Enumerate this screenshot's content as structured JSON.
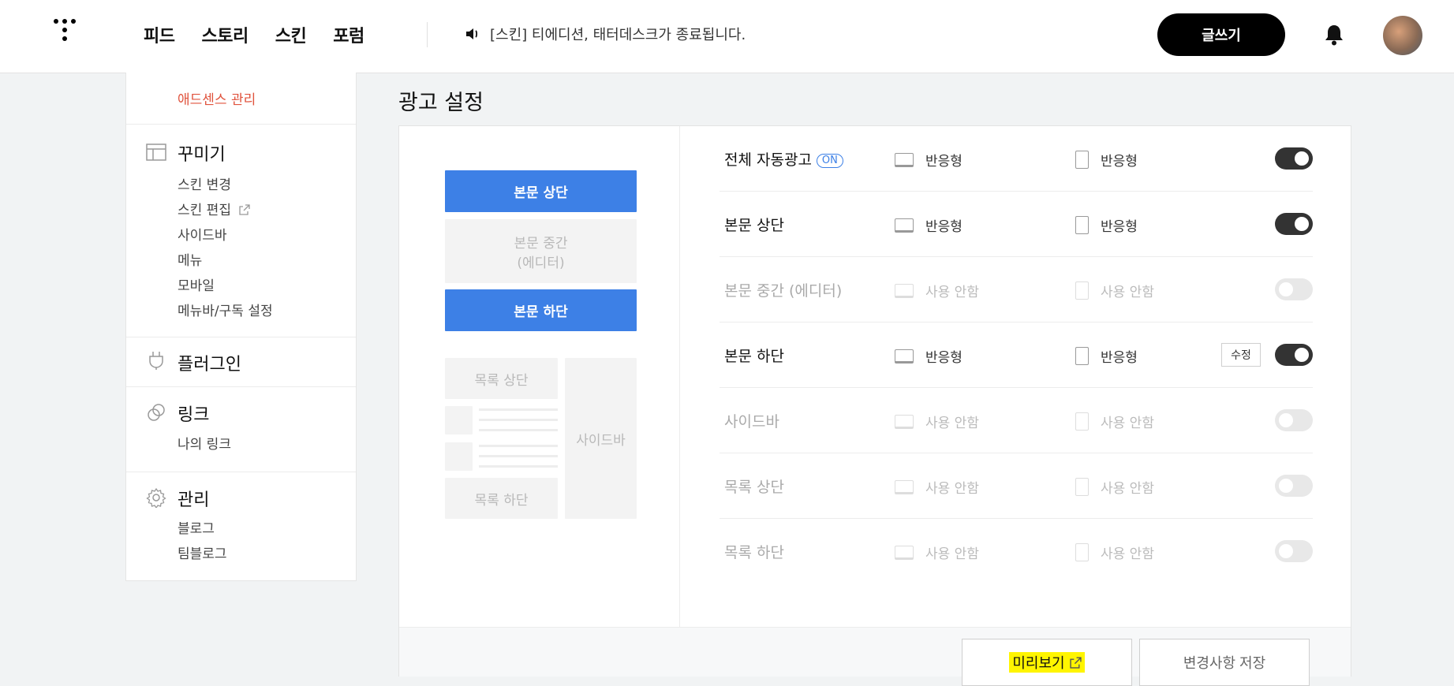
{
  "nav": {
    "items": [
      "피드",
      "스토리",
      "스킨",
      "포럼"
    ]
  },
  "notice": "[스킨] 티에디션, 태터데스크가 종료됩니다.",
  "header": {
    "write_label": "글쓰기"
  },
  "sidebar": {
    "adsense": "애드센스 관리",
    "groups": [
      {
        "title": "꾸미기",
        "icon": "layout-icon",
        "items": [
          "스킨 변경",
          "스킨 편집",
          "사이드바",
          "메뉴",
          "모바일",
          "메뉴바/구독 설정"
        ]
      },
      {
        "title": "플러그인",
        "icon": "plug-icon",
        "items": []
      },
      {
        "title": "링크",
        "icon": "link-icon",
        "items": [
          "나의 링크"
        ]
      },
      {
        "title": "관리",
        "icon": "gear-icon",
        "items": [
          "블로그",
          "팀블로그"
        ]
      }
    ]
  },
  "page": {
    "title": "광고 설정"
  },
  "preview": {
    "top": "본문 상단",
    "middle_line1": "본문 중간",
    "middle_line2": "(에디터)",
    "bottom": "본문 하단",
    "list_top": "목록 상단",
    "list_bottom": "목록 하단",
    "sidebar": "사이드바"
  },
  "rows": [
    {
      "label": "전체 자동광고",
      "badge": "ON",
      "pc": "반응형",
      "mobile": "반응형",
      "enabled": true
    },
    {
      "label": "본문 상단",
      "pc": "반응형",
      "mobile": "반응형",
      "enabled": true
    },
    {
      "label": "본문 중간 (에디터)",
      "pc": "사용 안함",
      "mobile": "사용 안함",
      "enabled": false
    },
    {
      "label": "본문 하단",
      "pc": "반응형",
      "mobile": "반응형",
      "enabled": true,
      "edit": "수정"
    },
    {
      "label": "사이드바",
      "pc": "사용 안함",
      "mobile": "사용 안함",
      "enabled": false
    },
    {
      "label": "목록 상단",
      "pc": "사용 안함",
      "mobile": "사용 안함",
      "enabled": false
    },
    {
      "label": "목록 하단",
      "pc": "사용 안함",
      "mobile": "사용 안함",
      "enabled": false
    }
  ],
  "footer": {
    "preview_label": "미리보기",
    "save_label": "변경사항 저장"
  },
  "colors": {
    "accent": "#3d80e6",
    "adsense": "#e0533d",
    "highlight": "#fff500"
  }
}
